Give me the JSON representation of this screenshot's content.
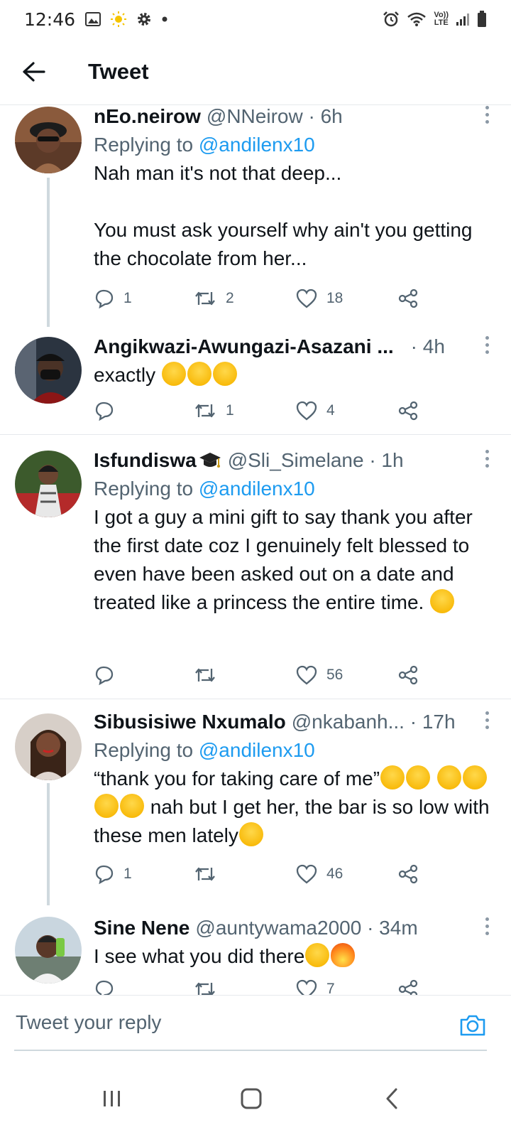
{
  "status": {
    "time": "12:46",
    "network_top": "Vo))",
    "network_bottom": "LTE"
  },
  "header": {
    "title": "Tweet"
  },
  "tweets": [
    {
      "name": "nEo.neirow",
      "handle": "@NNeirow",
      "time": "· 6h",
      "replying_prefix": "Replying to ",
      "replying_to": "@andilenx10",
      "text": "Nah man it's not that deep...\n\nYou must ask yourself why ain't you getting the chocolate from her...",
      "replies": "1",
      "retweets": "2",
      "likes": "18"
    },
    {
      "name": "Angikwazi-Awungazi-Asazani ...",
      "handle": "",
      "time": "· 4h",
      "text": "exactly",
      "replies": "",
      "retweets": "1",
      "likes": "4"
    },
    {
      "name": "Isfundiswa",
      "handle": "@Sli_Simelane",
      "time": "· 1h",
      "replying_prefix": "Replying to ",
      "replying_to": "@andilenx10",
      "text": "I got a guy a mini gift to say thank you after the first date coz I genuinely felt blessed to even have been asked out on a date and treated like a princess the entire time.",
      "replies": "",
      "retweets": "",
      "likes": "56"
    },
    {
      "name": "Sibusisiwe Nxumalo",
      "handle": "@nkabanh...",
      "time": "· 17h",
      "replying_prefix": "Replying to ",
      "replying_to": "@andilenx10",
      "text_part1": "“thank you for taking care of me”",
      "text_part2": " nah but I get her, the bar is so low with these men lately",
      "replies": "1",
      "retweets": "",
      "likes": "46"
    },
    {
      "name": "Sine Nene",
      "handle": "@auntywama2000",
      "time": "· 34m",
      "text": "I see what you did there",
      "replies": "",
      "retweets": "",
      "likes": "7"
    }
  ],
  "reply_bar": {
    "placeholder": "Tweet your reply"
  },
  "colors": {
    "accent": "#1d9bf0",
    "secondary_text": "#536471",
    "divider": "#e6e9ec",
    "thread_line": "#cfd9de"
  }
}
